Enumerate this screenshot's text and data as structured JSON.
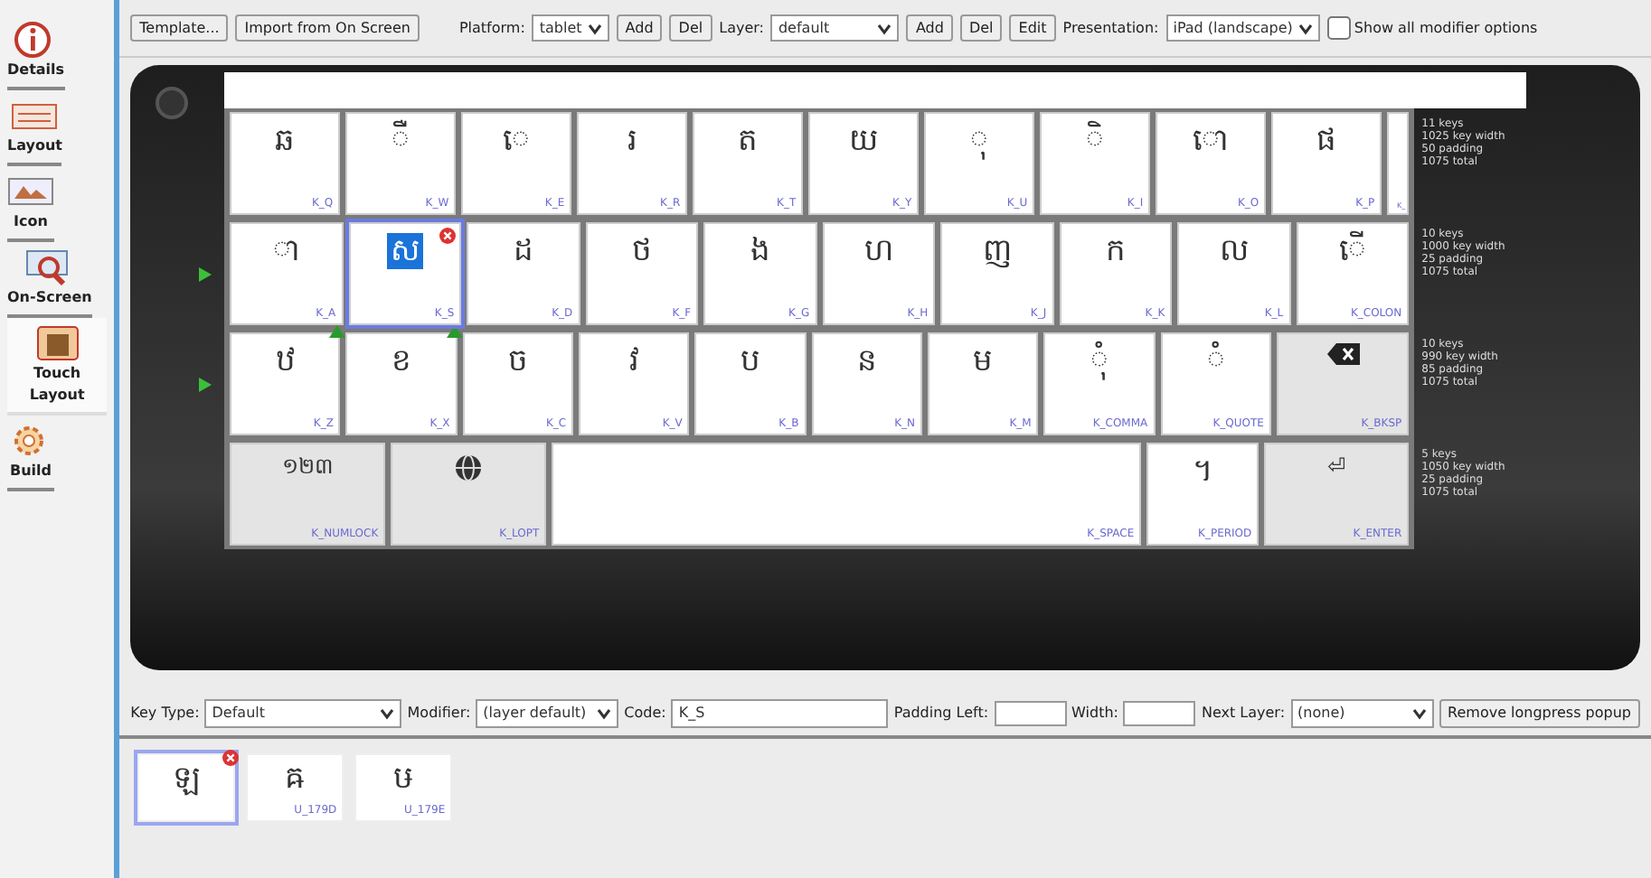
{
  "sidebar": {
    "items": [
      {
        "label": "Details",
        "selected": false
      },
      {
        "label": "Layout",
        "selected": false
      },
      {
        "label": "Icon",
        "selected": false
      },
      {
        "label": "On-Screen",
        "selected": false
      },
      {
        "label": "Touch Layout",
        "selected": true
      },
      {
        "label": "Build",
        "selected": false
      }
    ]
  },
  "toolbar": [
    {
      "kind": "button",
      "text": "Template..."
    },
    {
      "kind": "button",
      "text": "Import from On Screen"
    },
    {
      "kind": "gap"
    },
    {
      "kind": "label",
      "text": "Platform:"
    },
    {
      "kind": "select",
      "text": "tablet"
    },
    {
      "kind": "button",
      "text": "Add"
    },
    {
      "kind": "button",
      "text": "Del"
    },
    {
      "kind": "label",
      "text": "Layer:"
    },
    {
      "kind": "select",
      "text": "default"
    },
    {
      "kind": "button",
      "text": "Add"
    },
    {
      "kind": "button",
      "text": "Del"
    },
    {
      "kind": "button",
      "text": "Edit"
    },
    {
      "kind": "label",
      "text": "Presentation:"
    },
    {
      "kind": "select",
      "text": "iPad (landscape)"
    },
    {
      "kind": "checkbox",
      "text": "Show all modifier options",
      "checked": false
    }
  ],
  "keyboard": {
    "rows": [
      {
        "marker": false,
        "stats": "11 keys\n1025 key width\n50 padding\n1075 total",
        "keys": [
          {
            "kind": "normal",
            "text": "ឆ",
            "code": "K_Q",
            "selected": false,
            "flag": false
          },
          {
            "kind": "normal",
            "text": "ឺ",
            "code": "K_W",
            "selected": false,
            "flag": false
          },
          {
            "kind": "normal",
            "text": "េ",
            "code": "K_E",
            "selected": false,
            "flag": false
          },
          {
            "kind": "normal",
            "text": "រ",
            "code": "K_R",
            "selected": false,
            "flag": false
          },
          {
            "kind": "normal",
            "text": "ត",
            "code": "K_T",
            "selected": false,
            "flag": false
          },
          {
            "kind": "normal",
            "text": "យ",
            "code": "K_Y",
            "selected": false,
            "flag": false
          },
          {
            "kind": "normal",
            "text": "ុ",
            "code": "K_U",
            "selected": false,
            "flag": false
          },
          {
            "kind": "normal",
            "text": "ិ",
            "code": "K_I",
            "selected": false,
            "flag": false
          },
          {
            "kind": "normal",
            "text": "ោ",
            "code": "K_O",
            "selected": false,
            "flag": false
          },
          {
            "kind": "normal",
            "text": "ផ",
            "code": "K_P",
            "selected": false,
            "flag": false
          },
          {
            "kind": "sliver",
            "code": "K_",
            "selected": false,
            "flag": false
          }
        ]
      },
      {
        "marker": true,
        "stats": "10 keys\n1000 key width\n25 padding\n1075 total",
        "keys": [
          {
            "kind": "normal",
            "text": "ា",
            "code": "K_A",
            "selected": false,
            "flag": false
          },
          {
            "kind": "normal",
            "text": "ស",
            "code": "K_S",
            "selected": true,
            "flag": false
          },
          {
            "kind": "normal",
            "text": "ដ",
            "code": "K_D",
            "selected": false,
            "flag": false
          },
          {
            "kind": "normal",
            "text": "ថ",
            "code": "K_F",
            "selected": false,
            "flag": false
          },
          {
            "kind": "normal",
            "text": "ង",
            "code": "K_G",
            "selected": false,
            "flag": false
          },
          {
            "kind": "normal",
            "text": "ហ",
            "code": "K_H",
            "selected": false,
            "flag": false
          },
          {
            "kind": "normal",
            "text": "ញ",
            "code": "K_J",
            "selected": false,
            "flag": false
          },
          {
            "kind": "normal",
            "text": "ក",
            "code": "K_K",
            "selected": false,
            "flag": false
          },
          {
            "kind": "normal",
            "text": "ល",
            "code": "K_L",
            "selected": false,
            "flag": false
          },
          {
            "kind": "normal",
            "text": "ើ",
            "code": "K_COLON",
            "selected": false,
            "flag": false
          }
        ]
      },
      {
        "marker": true,
        "stats": "10 keys\n990 key width\n85 padding\n1075 total",
        "keys": [
          {
            "kind": "normal",
            "text": "ឋ",
            "code": "K_Z",
            "selected": false,
            "flag": true
          },
          {
            "kind": "normal",
            "text": "ខ",
            "code": "K_X",
            "selected": false,
            "flag": true
          },
          {
            "kind": "normal",
            "text": "ច",
            "code": "K_C",
            "selected": false,
            "flag": false
          },
          {
            "kind": "normal",
            "text": "វ",
            "code": "K_V",
            "selected": false,
            "flag": false
          },
          {
            "kind": "normal",
            "text": "ប",
            "code": "K_B",
            "selected": false,
            "flag": false
          },
          {
            "kind": "normal",
            "text": "ន",
            "code": "K_N",
            "selected": false,
            "flag": false
          },
          {
            "kind": "normal",
            "text": "ម",
            "code": "K_M",
            "selected": false,
            "flag": false
          },
          {
            "kind": "normal",
            "text": "ុំ",
            "code": "K_COMMA",
            "selected": false,
            "flag": false
          },
          {
            "kind": "normal",
            "text": "ំ",
            "code": "K_QUOTE",
            "selected": false,
            "flag": false
          },
          {
            "kind": "backspace",
            "code": "K_BKSP",
            "selected": false,
            "flag": false
          }
        ]
      },
      {
        "marker": false,
        "stats": "5 keys\n1050 key width\n25 padding\n1075 total",
        "keys": [
          {
            "kind": "special",
            "text": "១២៣",
            "code": "K_NUMLOCK",
            "selected": false,
            "flag": false
          },
          {
            "kind": "globe",
            "code": "K_LOPT",
            "selected": false,
            "flag": false
          },
          {
            "kind": "space",
            "code": "K_SPACE",
            "selected": false,
            "flag": false
          },
          {
            "kind": "normal",
            "text": "។",
            "code": "K_PERIOD",
            "selected": false,
            "flag": false
          },
          {
            "kind": "special",
            "text": "⏎",
            "code": "K_ENTER",
            "selected": false,
            "flag": false
          }
        ]
      }
    ]
  },
  "key_properties": [
    {
      "kind": "select",
      "label": "Key Type:",
      "value": "Default"
    },
    {
      "kind": "select",
      "label": "Modifier:",
      "value": "(layer default)"
    },
    {
      "kind": "input",
      "label": "Code:",
      "value": "K_S"
    },
    {
      "kind": "input",
      "label": "Padding Left:"
    },
    {
      "kind": "input",
      "label": "Width:"
    },
    {
      "kind": "select",
      "label": "Next Layer:",
      "value": "(none)"
    },
    {
      "kind": "button",
      "label": "Remove longpress popup"
    }
  ],
  "longpress": [
    {
      "text": "ឡ",
      "selected": true
    },
    {
      "text": "ឝ",
      "code": "U_179D",
      "selected": false
    },
    {
      "text": "ឞ",
      "code": "U_179E",
      "selected": false
    }
  ]
}
